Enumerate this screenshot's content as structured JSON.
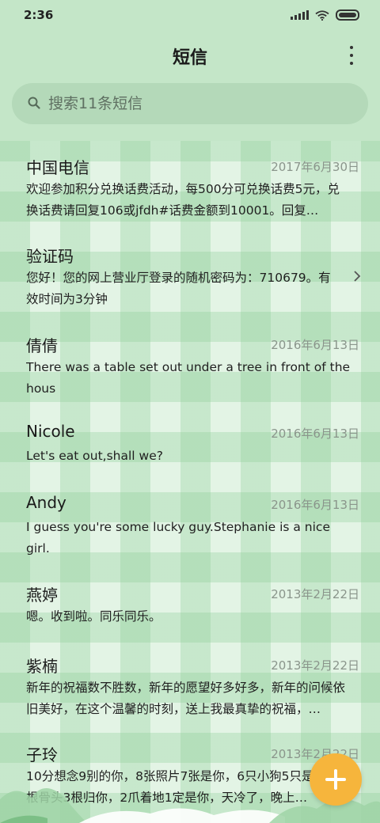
{
  "status": {
    "time": "2:36"
  },
  "header": {
    "title": "短信",
    "more": "⋮"
  },
  "search": {
    "placeholder": "搜索11条短信"
  },
  "messages": [
    {
      "sender": "中国电信",
      "date": "2017年6月30日",
      "preview": "欢迎参加积分兑换话费活动，每500分可兑换话费5元，兑换话费请回复106或jfdh#话费金额到10001。回复…"
    },
    {
      "sender": "验证码",
      "date": "",
      "preview": "您好！您的网上营业厅登录的随机密码为：710679。有效时间为3分钟"
    },
    {
      "sender": "倩倩",
      "date": "2016年6月13日",
      "preview": "There was a table set out under a tree in front of the hous"
    },
    {
      "sender": "Nicole",
      "date": "2016年6月13日",
      "preview": "Let's eat out,shall we?"
    },
    {
      "sender": "Andy",
      "date": "2016年6月13日",
      "preview": "I guess you're some lucky guy.Stephanie is a nice girl."
    },
    {
      "sender": "燕婷",
      "date": "2013年2月22日",
      "preview": "嗯。收到啦。同乐同乐。"
    },
    {
      "sender": "紫楠",
      "date": "2013年2月22日",
      "preview": "新年的祝福数不胜数，新年的愿望好多好多，新年的问候依旧美好，在这个温馨的时刻，送上我最真挚的祝福，…"
    },
    {
      "sender": "子玲",
      "date": "2013年2月22日",
      "preview": "10分想念9别的你，8张照片7张是你，6只小狗5只是你，4根骨头3根归你，2爪着地1定是你，天冷了，晚上…"
    }
  ],
  "colors": {
    "accent": "#f6b53c",
    "header_bg": "#c4e6c8",
    "search_bg": "#b4d9b9"
  },
  "icons": {
    "search": "search-icon",
    "more": "more-vertical-icon",
    "chevron": "chevron-right-icon",
    "compose": "plus-icon"
  }
}
